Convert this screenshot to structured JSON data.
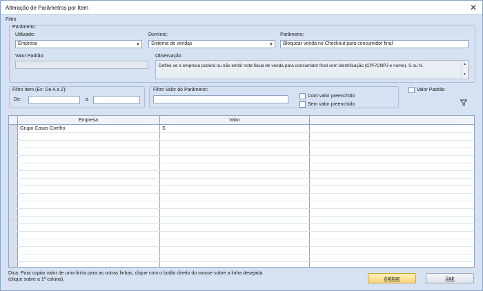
{
  "window": {
    "title": "Alteração de Parâmetros por Item",
    "close_icon": "close-icon"
  },
  "filtro": {
    "label": "Filtro",
    "parametro_group": "Parâmetro",
    "utilizado": {
      "label": "Utilizado:",
      "value": "Empresa"
    },
    "dominio": {
      "label": "Domínio:",
      "value": "Sistema de vendas"
    },
    "parametro": {
      "label": "Parâmetro:",
      "value": "Bloquear venda no Checkout para consumidor final"
    },
    "valor_padrao": {
      "label": "Valor Padrão:",
      "value": ""
    },
    "observacao": {
      "label": "Observação",
      "value": "Define se a empresa poderá ou não emitir nota fiscal de venda para consumidor final sem identificação (CPF/CNPJ e nome). S ou N."
    }
  },
  "filtro_item": {
    "label": "Filtro Item (Ex: De A a Z):",
    "de_label": "De:",
    "a_label": "a",
    "de_value": "",
    "a_value": ""
  },
  "filtro_valor": {
    "label": "Filtro Valor do Parâmetro:",
    "value": "",
    "com_valor": "Com valor preenchido",
    "sem_valor": "Sem valor preenchido"
  },
  "valor_padrao_check": "Valor Padrão",
  "filter_icon": "filter-icon",
  "grid": {
    "columns": [
      "Empresa",
      "Valor"
    ],
    "rows": [
      {
        "empresa": "Grupo Casas Coelho",
        "valor": "S"
      }
    ]
  },
  "dica": "Dica: Para copiar valor de uma linha para as outras linhas, clique com o botão direito do mouse sobre a linha desejada (clique sobre a 1ª coluna).",
  "buttons": {
    "aplicar": "Aplicar",
    "sair": "Sair"
  },
  "colors": {
    "accent_button": "#f7d57a",
    "frame_bg": "#d6e2f2"
  }
}
